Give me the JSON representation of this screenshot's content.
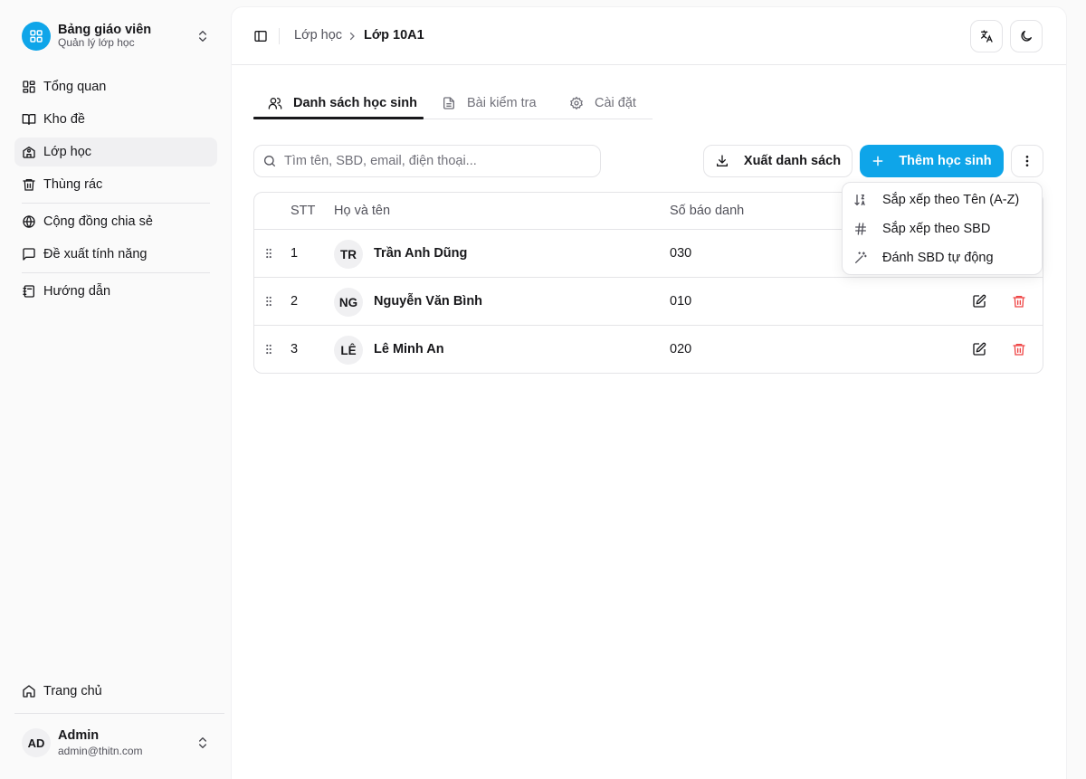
{
  "sidebar": {
    "brand": {
      "title": "Bảng giáo viên",
      "subtitle": "Quản lý lớp học",
      "accent": "#0ea5e9"
    },
    "nav": [
      {
        "label": "Tổng quan",
        "icon": "dashboard-icon"
      },
      {
        "label": "Kho đề",
        "icon": "book-open-icon"
      },
      {
        "label": "Lớp học",
        "icon": "school-icon",
        "active": true
      },
      {
        "label": "Thùng rác",
        "icon": "trash-icon"
      },
      {
        "label": "Cộng đồng chia sẻ",
        "icon": "globe-icon"
      },
      {
        "label": "Đề xuất tính năng",
        "icon": "message-square-icon"
      },
      {
        "label": "Hướng dẫn",
        "icon": "notebook-icon"
      }
    ],
    "home": {
      "label": "Trang chủ",
      "icon": "home-icon"
    },
    "user": {
      "initials": "AD",
      "name": "Admin",
      "email": "admin@thitn.com"
    }
  },
  "header": {
    "breadcrumb": [
      "Lớp học",
      "Lớp 10A1"
    ],
    "icons": [
      "sidebar-toggle-icon",
      "translate-icon",
      "moon-icon"
    ]
  },
  "tabs": [
    {
      "label": "Danh sách học sinh",
      "icon": "users-icon",
      "active": true
    },
    {
      "label": "Bài kiểm tra",
      "icon": "file-text-icon"
    },
    {
      "label": "Cài đặt",
      "icon": "settings-icon"
    }
  ],
  "toolbar": {
    "search_placeholder": "Tìm tên, SBD, email, điện thoại...",
    "export_label": "Xuất danh sách",
    "add_label": "Thêm học sinh",
    "primary_color": "#0ea5e9"
  },
  "table": {
    "columns": [
      "STT",
      "Họ và tên",
      "Số báo danh"
    ],
    "rows": [
      {
        "stt": "1",
        "initials": "TR",
        "name": "Trần Anh Dũng",
        "sbd": "030"
      },
      {
        "stt": "2",
        "initials": "NG",
        "name": "Nguyễn Văn Bình",
        "sbd": "010"
      },
      {
        "stt": "3",
        "initials": "LÊ",
        "name": "Lê Minh An",
        "sbd": "020"
      }
    ]
  },
  "dropdown_menu": [
    {
      "label": "Sắp xếp theo Tên (A-Z)",
      "icon": "sort-az-icon"
    },
    {
      "label": "Sắp xếp theo SBD",
      "icon": "hash-icon"
    },
    {
      "label": "Đánh SBD tự động",
      "icon": "magic-wand-icon"
    }
  ],
  "colors": {
    "delete": "#ef4444"
  }
}
